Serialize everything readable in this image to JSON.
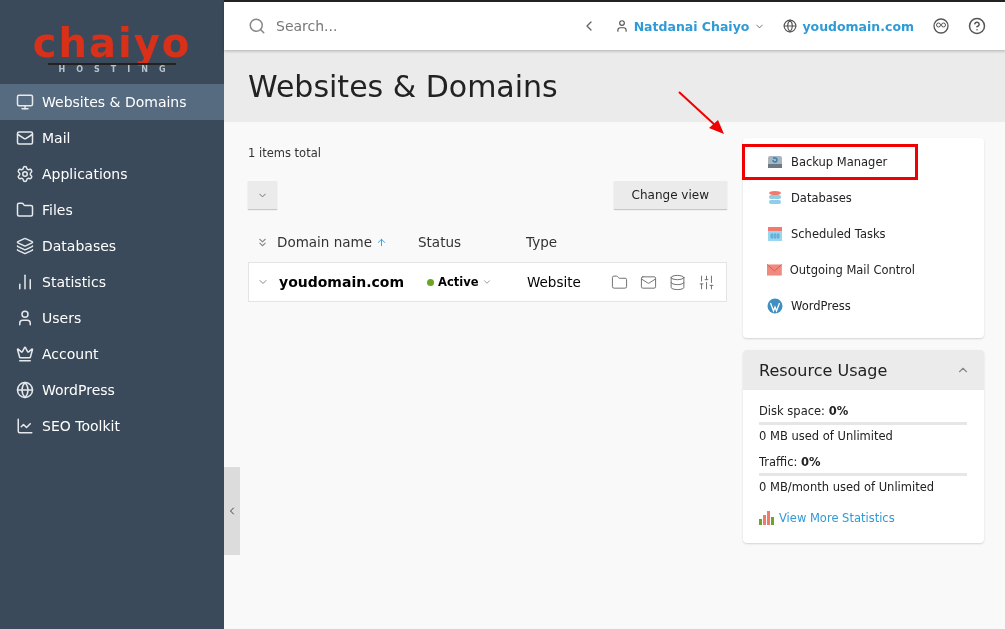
{
  "logo": {
    "brand": "chaiyo",
    "tagline": "HOSTING"
  },
  "sidebar": {
    "items": [
      {
        "label": "Websites & Domains",
        "selected": true
      },
      {
        "label": "Mail",
        "selected": false
      },
      {
        "label": "Applications",
        "selected": false
      },
      {
        "label": "Files",
        "selected": false
      },
      {
        "label": "Databases",
        "selected": false
      },
      {
        "label": "Statistics",
        "selected": false
      },
      {
        "label": "Users",
        "selected": false
      },
      {
        "label": "Account",
        "selected": false
      },
      {
        "label": "WordPress",
        "selected": false
      },
      {
        "label": "SEO Toolkit",
        "selected": false
      }
    ]
  },
  "header": {
    "search": {
      "placeholder": "Search..."
    },
    "user": "Natdanai Chaiyo",
    "domain": "youdomain.com"
  },
  "page_title": "Websites & Domains",
  "list": {
    "total": "1 items total",
    "change_view": "Change view",
    "columns": [
      "Domain name",
      "Status",
      "Type"
    ],
    "rows": [
      {
        "domain": "youdomain.com",
        "status": "Active",
        "type": "Website"
      }
    ]
  },
  "quick_links": [
    {
      "label": "Backup Manager",
      "highlighted": true
    },
    {
      "label": "Databases",
      "highlighted": false
    },
    {
      "label": "Scheduled Tasks",
      "highlighted": false
    },
    {
      "label": "Outgoing Mail Control",
      "highlighted": false
    },
    {
      "label": "WordPress",
      "highlighted": false
    }
  ],
  "resource_usage": {
    "title": "Resource Usage",
    "items": [
      {
        "label": "Disk space: **0%**",
        "detail": "0 MB used of Unlimited",
        "level": 0
      },
      {
        "label": "Traffic: **0%**",
        "detail": "0 MB/month used of Unlimited",
        "level": 0
      }
    ],
    "link": "View More Statistics"
  }
}
